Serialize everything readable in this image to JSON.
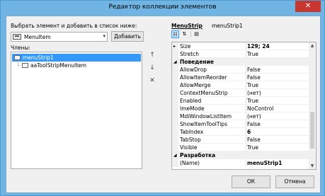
{
  "window": {
    "title": "Редактор коллекции элементов",
    "close": "✕"
  },
  "left": {
    "add_label": "Выбрать элемент и добавить в список ниже:",
    "combo_value": "MenuItem",
    "add_button": "Добавить",
    "members_label": "Члены:",
    "members": [
      "menuStrip1",
      "aaToolStripMenuItem"
    ],
    "up_icon": "↑",
    "down_icon": "↓",
    "delete_icon": "✕"
  },
  "right": {
    "header": "MenuStrip",
    "object_name": "menuStrip1",
    "props": [
      {
        "name": "Size",
        "value": "129; 24",
        "bold": true,
        "expand": "▸"
      },
      {
        "name": "Stretch",
        "value": "True"
      },
      {
        "category": "Поведение",
        "toggle": "◢"
      },
      {
        "name": "AllowDrop",
        "value": "False"
      },
      {
        "name": "AllowItemReorder",
        "value": "False"
      },
      {
        "name": "AllowMerge",
        "value": "True"
      },
      {
        "name": "ContextMenuStrip",
        "value": "(нет)"
      },
      {
        "name": "Enabled",
        "value": "True"
      },
      {
        "name": "ImeMode",
        "value": "NoControl"
      },
      {
        "name": "MdiWindowListItem",
        "value": "(нет)"
      },
      {
        "name": "ShowItemToolTips",
        "value": "False"
      },
      {
        "name": "TabIndex",
        "value": "6",
        "bold": true
      },
      {
        "name": "TabStop",
        "value": "False"
      },
      {
        "name": "Visible",
        "value": "True"
      },
      {
        "category": "Разработка",
        "toggle": "◢"
      },
      {
        "name": "(Name)",
        "value": "menuStrip1",
        "bold": true
      }
    ]
  },
  "footer": {
    "ok": "ОК",
    "cancel": "Отмена"
  }
}
